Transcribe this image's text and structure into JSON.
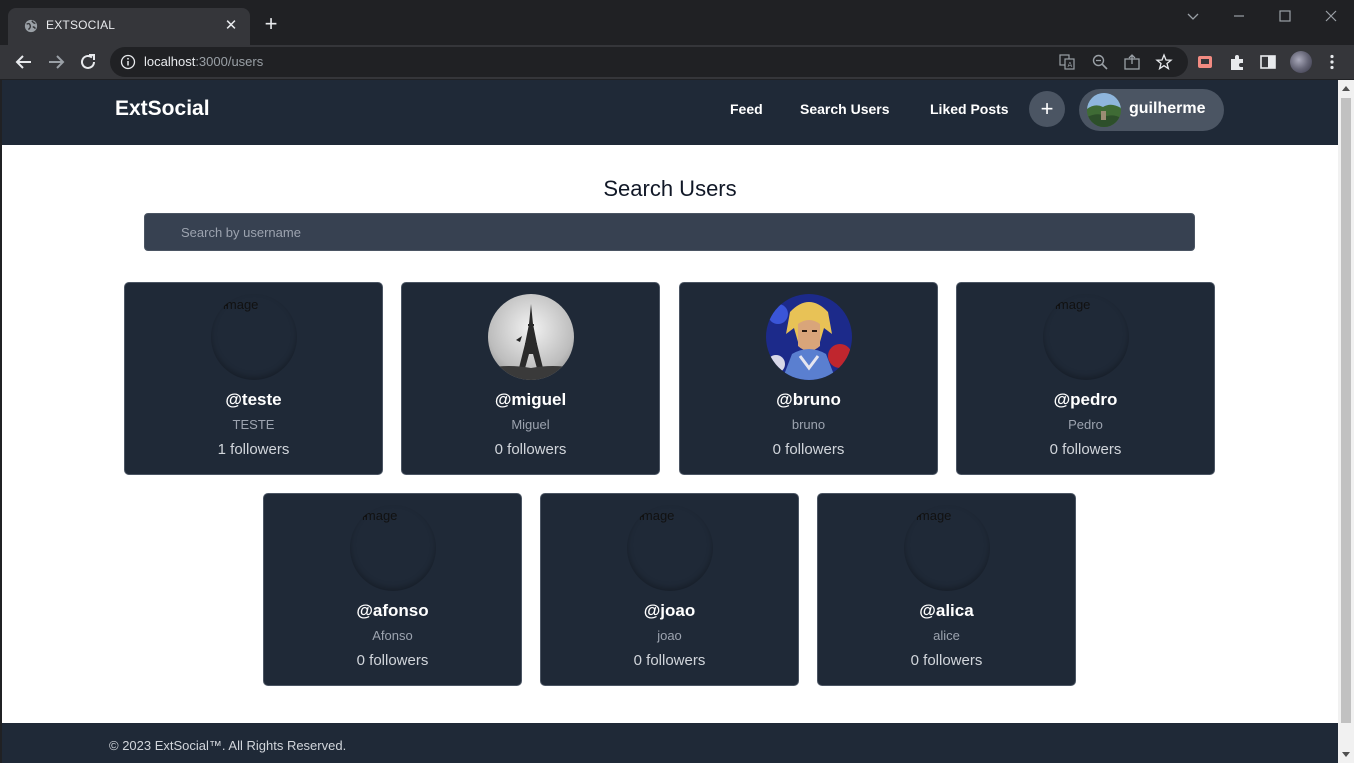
{
  "browser": {
    "tab_title": "EXTSOCIAL",
    "url_host": "localhost",
    "url_path": ":3000/users"
  },
  "app": {
    "brand": "ExtSocial",
    "nav": [
      "Feed",
      "Search Users",
      "Liked Posts"
    ],
    "add_label": "+",
    "current_user": "guilherme"
  },
  "main": {
    "title": "Search Users",
    "search_placeholder": "Search by username",
    "broken_image_alt": "image",
    "users": [
      {
        "handle": "@teste",
        "name": "TESTE",
        "followers": "1 followers",
        "avatar": "broken"
      },
      {
        "handle": "@miguel",
        "name": "Miguel",
        "followers": "0 followers",
        "avatar": "eiffel-tower-photo"
      },
      {
        "handle": "@bruno",
        "name": "bruno",
        "followers": "0 followers",
        "avatar": "anime-character-photo"
      },
      {
        "handle": "@pedro",
        "name": "Pedro",
        "followers": "0 followers",
        "avatar": "broken"
      },
      {
        "handle": "@afonso",
        "name": "Afonso",
        "followers": "0 followers",
        "avatar": "broken"
      },
      {
        "handle": "@joao",
        "name": "joao",
        "followers": "0 followers",
        "avatar": "broken"
      },
      {
        "handle": "@alica",
        "name": "alice",
        "followers": "0 followers",
        "avatar": "broken"
      }
    ]
  },
  "footer": {
    "text": "© 2023 ExtSocial™. All Rights Reserved."
  }
}
